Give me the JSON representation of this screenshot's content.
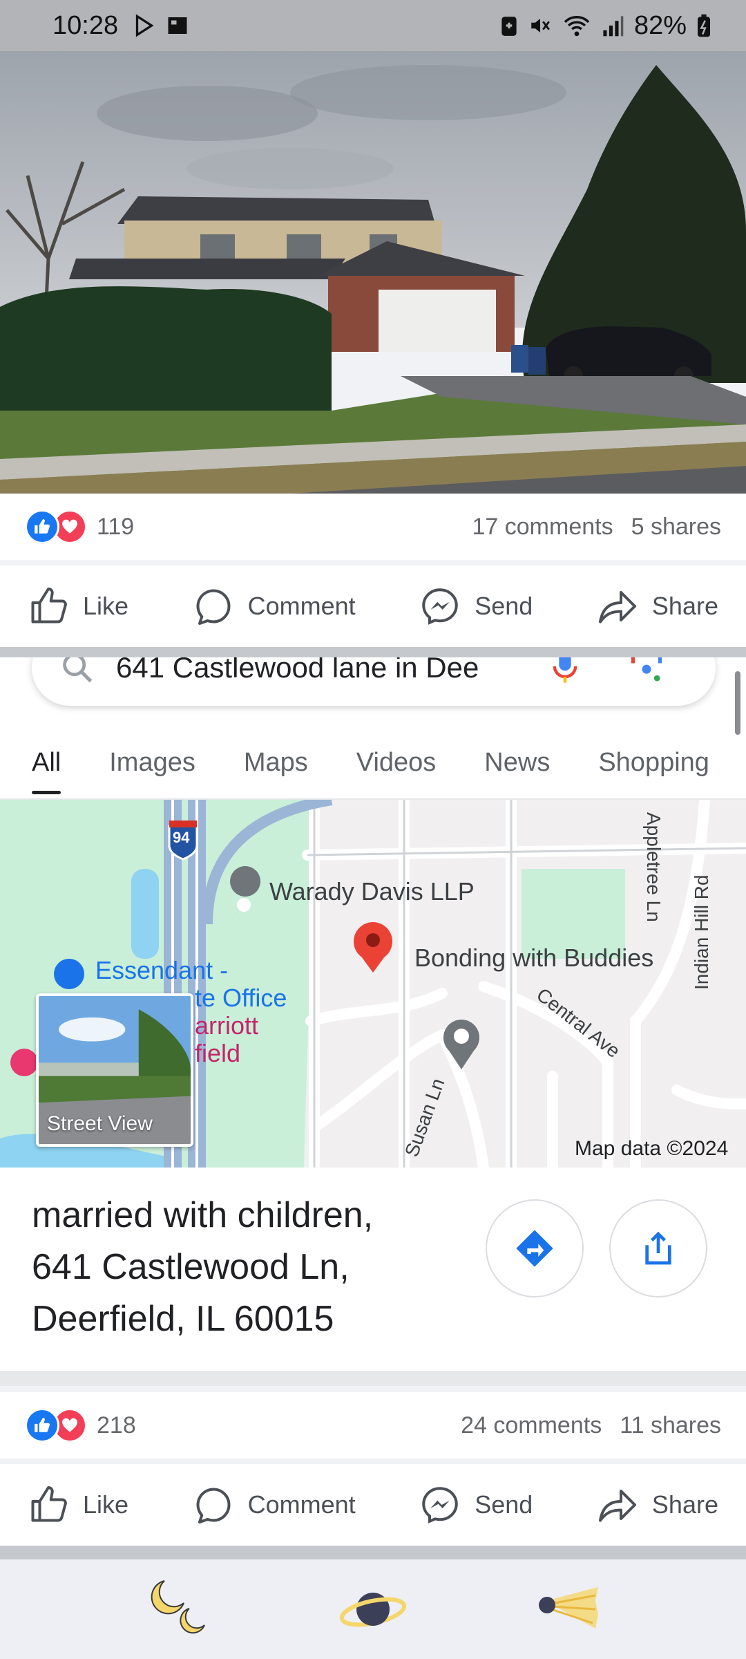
{
  "status_bar": {
    "time": "10:28",
    "battery": "82%"
  },
  "post1": {
    "reaction_count": "119",
    "comments": "17 comments",
    "shares": "5 shares"
  },
  "actions": {
    "like": "Like",
    "comment": "Comment",
    "send": "Send",
    "share": "Share"
  },
  "google": {
    "query": "641 Castlewood lane in Dee",
    "tabs": [
      "All",
      "Images",
      "Maps",
      "Videos",
      "News",
      "Shopping"
    ],
    "map": {
      "highway_shield": "94",
      "labels": {
        "waradys": "Warady Davis LLP",
        "essendant": "Essendant -",
        "essendant2": "te Office",
        "marriott1": "arriott",
        "marriott2": "field",
        "bonding": "Bonding with Buddies",
        "central": "Central Ave",
        "susan": "Susan Ln",
        "appletree": "Appletree Ln",
        "indianhill": "Indian Hill Rd",
        "mapdata": "Map data ©2024"
      },
      "street_view_label": "Street View"
    },
    "place": {
      "line1": "married with children,",
      "line2": "641 Castlewood Ln,",
      "line3": "Deerfield, IL 60015"
    }
  },
  "post2": {
    "reaction_count": "218",
    "comments": "24 comments",
    "shares": "11 shares"
  },
  "colors": {
    "like_blue": "#1877f2",
    "love_red": "#f33e58",
    "maps_blue": "#1a73e8",
    "pin_red": "#ea4335"
  }
}
